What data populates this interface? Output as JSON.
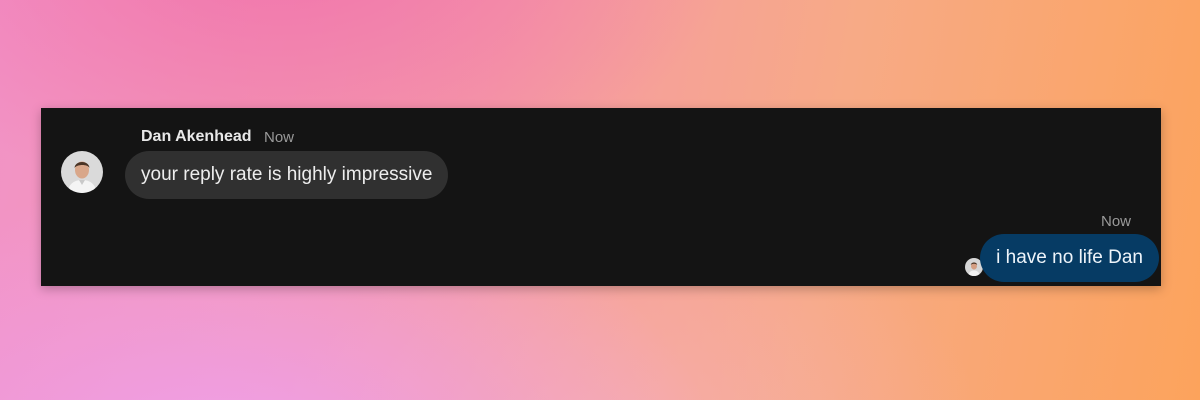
{
  "colors": {
    "panel_background": "#141414",
    "incoming_bubble": "#303030",
    "outgoing_bubble": "#063b64",
    "timestamp_text": "#9a9a9a"
  },
  "conversation": {
    "incoming": {
      "sender": "Dan Akenhead",
      "time": "Now",
      "text": "your reply rate is highly impressive",
      "avatar": "user-avatar-icon"
    },
    "outgoing": {
      "time": "Now",
      "text": "i have no life Dan",
      "avatar": "self-avatar-icon"
    }
  }
}
